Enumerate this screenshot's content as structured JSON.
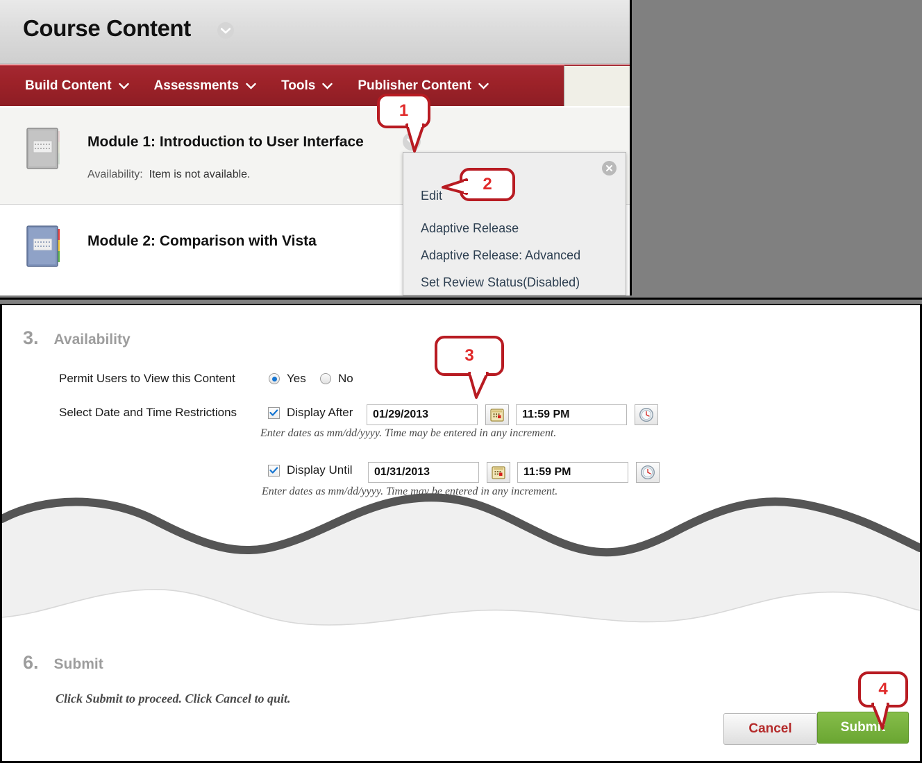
{
  "top_window": {
    "page_title": "Course Content",
    "title_chevron_icon": "chevron-down-icon",
    "action_bar": {
      "items": [
        {
          "label": "Build Content",
          "icon": "chevron-down-icon"
        },
        {
          "label": "Assessments",
          "icon": "chevron-down-icon"
        },
        {
          "label": "Tools",
          "icon": "chevron-down-icon"
        },
        {
          "label": "Publisher Content",
          "icon": "chevron-down-icon"
        }
      ]
    },
    "content_items": [
      {
        "title": "Module 1: Introduction to User Interface",
        "availability_label": "Availability:",
        "availability_value": "Item is not available.",
        "icon": "folder-unavailable-icon",
        "chevron_icon": "chevron-down-icon"
      },
      {
        "title": "Module 2: Comparison with Vista",
        "icon": "folder-icon"
      }
    ],
    "context_menu": {
      "close_icon": "close-circle-icon",
      "items": [
        "Edit",
        "Adaptive Release",
        "Adaptive Release: Advanced",
        "Set Review Status(Disabled)"
      ]
    }
  },
  "form_panel": {
    "availability_section": {
      "number": "3.",
      "heading": "Availability",
      "permit_label": "Permit Users to View this Content",
      "permit_options": [
        {
          "label": "Yes",
          "selected": true
        },
        {
          "label": "No",
          "selected": false
        }
      ],
      "restrictions_label": "Select Date and Time Restrictions",
      "display_after": {
        "checkbox_label": "Display After",
        "checked": true,
        "date_value": "01/29/2013",
        "calendar_icon": "calendar-icon",
        "time_value": "11:59 PM",
        "clock_icon": "clock-icon",
        "hint": "Enter dates as mm/dd/yyyy. Time may be entered in any increment."
      },
      "display_until": {
        "checkbox_label": "Display Until",
        "checked": true,
        "date_value": "01/31/2013",
        "calendar_icon": "calendar-icon",
        "time_value": "11:59 PM",
        "clock_icon": "clock-icon",
        "hint": "Enter dates as mm/dd/yyyy. Time may be entered in any increment."
      }
    },
    "submit_section": {
      "number": "6.",
      "heading": "Submit",
      "hint": "Click Submit to proceed. Click Cancel to quit.",
      "cancel_label": "Cancel",
      "submit_label": "Submit"
    }
  },
  "callouts": [
    {
      "number": "1"
    },
    {
      "number": "2"
    },
    {
      "number": "3"
    },
    {
      "number": "4"
    }
  ],
  "colors": {
    "brand_red": "#9d2229",
    "callout_red": "#b81b22",
    "submit_green": "#6aa632",
    "cancel_red_text": "#b42a2a",
    "backdrop_gray": "#808080",
    "section_heading_gray": "#9d9d9d"
  }
}
